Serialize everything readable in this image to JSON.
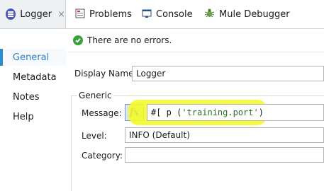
{
  "tabs": {
    "active": {
      "label": "Logger",
      "close": "×"
    },
    "problems": "Problems",
    "console": "Console",
    "debugger": "Mule Debugger"
  },
  "sidebar": {
    "items": [
      {
        "label": "General"
      },
      {
        "label": "Metadata"
      },
      {
        "label": "Notes"
      },
      {
        "label": "Help"
      }
    ]
  },
  "status": {
    "text": "There are no errors."
  },
  "display_name": {
    "label": "Display Name:",
    "value": "Logger"
  },
  "generic": {
    "title": "Generic",
    "message_label": "Message:",
    "fx_label": "fx",
    "message_prefix": "#[ p (",
    "message_string": "'training.port'",
    "message_suffix": ")",
    "level_label": "Level:",
    "level_value": "INFO (Default)",
    "category_label": "Category:",
    "category_value": ""
  },
  "colors": {
    "accent": "#2e8bd0",
    "highlight": "#f4f92a",
    "success": "#3aa23a"
  }
}
